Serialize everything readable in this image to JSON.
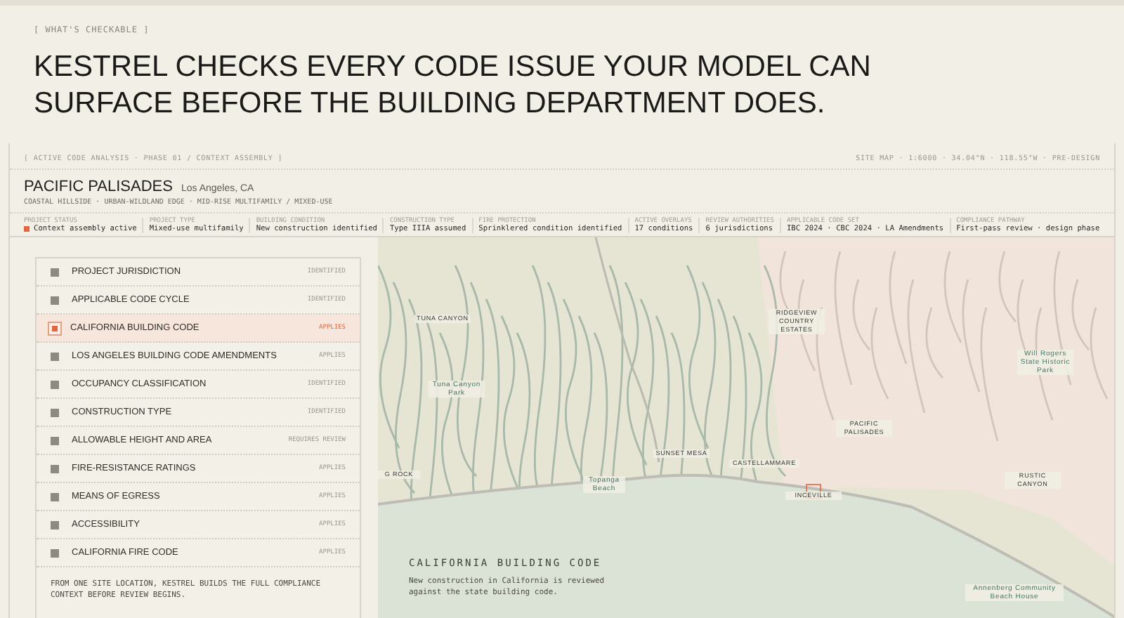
{
  "eyebrow": "[ WHAT'S CHECKABLE ]",
  "headline": "KESTREL CHECKS EVERY CODE ISSUE YOUR MODEL CAN SURFACE BEFORE THE BUILDING DEPARTMENT DOES.",
  "panel": {
    "breadcrumb": "[ ACTIVE CODE ANALYSIS · PHASE 01 / CONTEXT ASSEMBLY ]",
    "map_meta": "SITE MAP · 1:6000 · 34.04°N · 118.55°W · PRE-DESIGN",
    "site": {
      "name": "PACIFIC PALISADES",
      "location": "Los Angeles, CA",
      "tags": "COASTAL HILLSIDE · URBAN-WILDLAND EDGE · MID-RISE MULTIFAMILY / MIXED-USE"
    },
    "stats": [
      {
        "label": "PROJECT STATUS",
        "value": "Context assembly active",
        "active": true
      },
      {
        "label": "PROJECT TYPE",
        "value": "Mixed-use multifamily",
        "active": false
      },
      {
        "label": "BUILDING CONDITION",
        "value": "New construction identified",
        "active": false
      },
      {
        "label": "CONSTRUCTION TYPE",
        "value": "Type IIIA assumed",
        "active": false
      },
      {
        "label": "FIRE PROTECTION",
        "value": "Sprinklered condition identified",
        "active": false
      },
      {
        "label": "ACTIVE OVERLAYS",
        "value": "17 conditions",
        "active": false
      },
      {
        "label": "REVIEW AUTHORITIES",
        "value": "6 jurisdictions",
        "active": false
      },
      {
        "label": "APPLICABLE CODE SET",
        "value": "IBC 2024 · CBC 2024 · LA Amendments",
        "active": false
      },
      {
        "label": "COMPLIANCE PATHWAY",
        "value": "First-pass review · design phase",
        "active": false
      }
    ],
    "checks": [
      {
        "name": "PROJECT JURISDICTION",
        "status": "IDENTIFIED",
        "selected": false
      },
      {
        "name": "APPLICABLE CODE CYCLE",
        "status": "IDENTIFIED",
        "selected": false
      },
      {
        "name": "CALIFORNIA BUILDING CODE",
        "status": "APPLIES",
        "selected": true
      },
      {
        "name": "LOS ANGELES BUILDING CODE AMENDMENTS",
        "status": "APPLIES",
        "selected": false
      },
      {
        "name": "OCCUPANCY CLASSIFICATION",
        "status": "IDENTIFIED",
        "selected": false
      },
      {
        "name": "CONSTRUCTION TYPE",
        "status": "IDENTIFIED",
        "selected": false
      },
      {
        "name": "ALLOWABLE HEIGHT AND AREA",
        "status": "REQUIRES REVIEW",
        "selected": false
      },
      {
        "name": "FIRE-RESISTANCE RATINGS",
        "status": "APPLIES",
        "selected": false
      },
      {
        "name": "MEANS OF EGRESS",
        "status": "APPLIES",
        "selected": false
      },
      {
        "name": "ACCESSIBILITY",
        "status": "APPLIES",
        "selected": false
      },
      {
        "name": "CALIFORNIA FIRE CODE",
        "status": "APPLIES",
        "selected": false
      }
    ],
    "footnote": "FROM ONE SITE LOCATION, KESTREL BUILDS THE FULL COMPLIANCE CONTEXT BEFORE REVIEW BEGINS.",
    "map": {
      "labels": [
        "TUNA CANYON",
        "RIDGEVIEW COUNTRY ESTATES",
        "Will Rogers State Historic Park",
        "Tuna Canyon Park",
        "PACIFIC PALISADES",
        "SUNSET MESA",
        "CASTELLAMMARE",
        "G ROCK",
        "RUSTIC CANYON",
        "Topanga Beach",
        "INCEVILLE",
        "Annenberg Community Beach House"
      ],
      "caption": {
        "title": "CALIFORNIA BUILDING CODE",
        "text": "New construction in California is reviewed against the state building code."
      }
    }
  }
}
